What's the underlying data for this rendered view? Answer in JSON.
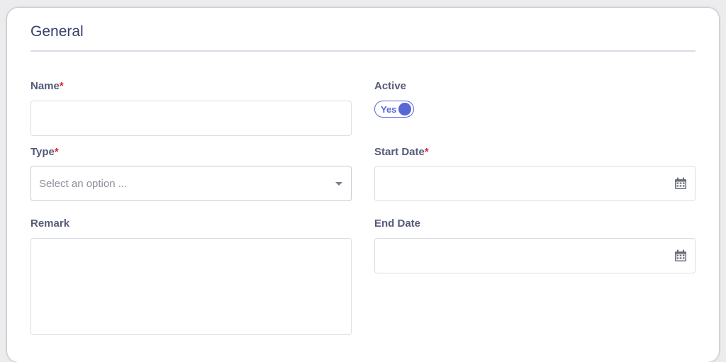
{
  "section": {
    "title": "General"
  },
  "fields": {
    "name": {
      "label": "Name",
      "required_mark": "*",
      "value": ""
    },
    "active": {
      "label": "Active",
      "toggle_label": "Yes",
      "state": true
    },
    "type": {
      "label": "Type",
      "required_mark": "*",
      "placeholder": "Select an option ..."
    },
    "start_date": {
      "label": "Start Date",
      "required_mark": "*",
      "value": "",
      "icon": "calendar-icon"
    },
    "remark": {
      "label": "Remark",
      "value": ""
    },
    "end_date": {
      "label": "End Date",
      "value": "",
      "icon": "calendar-icon"
    }
  },
  "colors": {
    "accent": "#5966d6",
    "required": "#e0202a",
    "title": "#3a3f6b"
  }
}
